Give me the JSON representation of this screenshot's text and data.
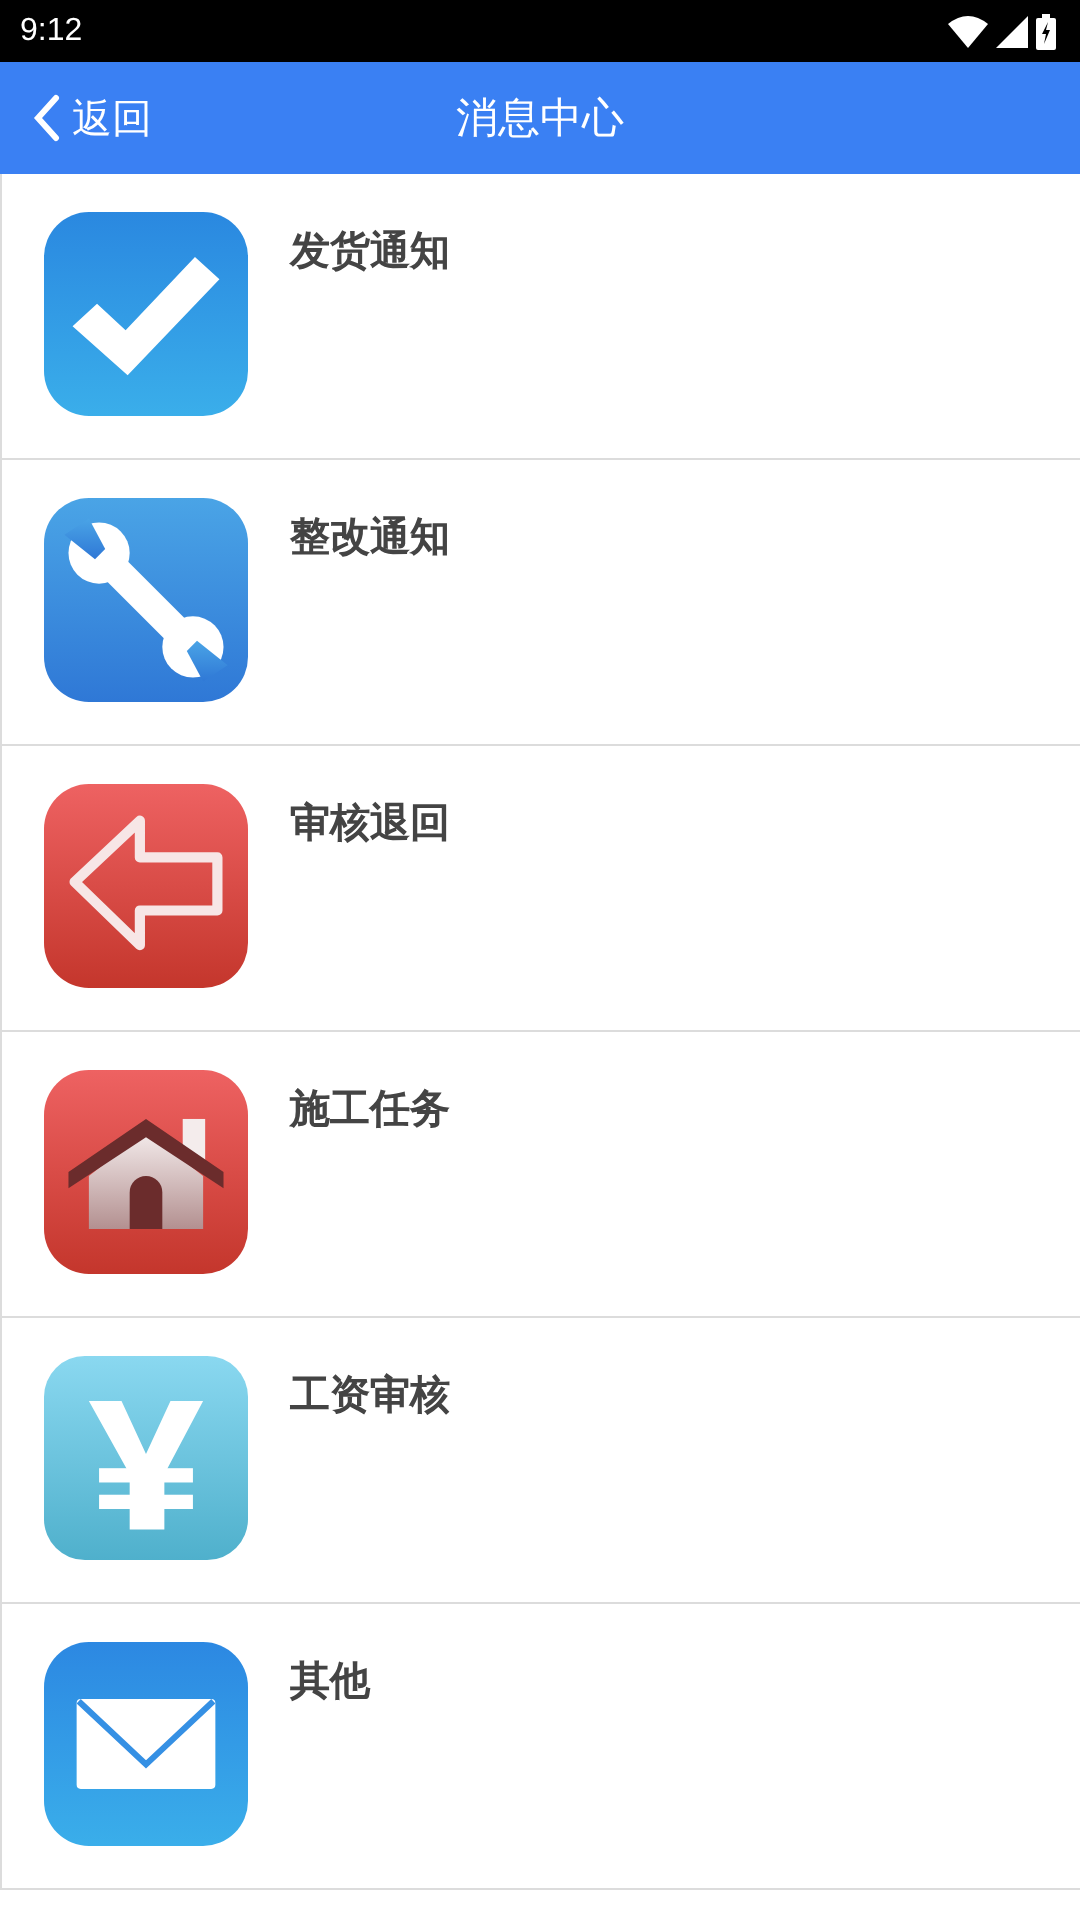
{
  "status_bar": {
    "time": "9:12"
  },
  "app_bar": {
    "back_label": "返回",
    "title": "消息中心"
  },
  "items": [
    {
      "kind": "check",
      "title": "发货通知"
    },
    {
      "kind": "wrench",
      "title": "整改通知"
    },
    {
      "kind": "back",
      "title": "审核退回"
    },
    {
      "kind": "house",
      "title": "施工任务"
    },
    {
      "kind": "yen",
      "title": "工资审核"
    },
    {
      "kind": "mail",
      "title": "其他"
    }
  ]
}
